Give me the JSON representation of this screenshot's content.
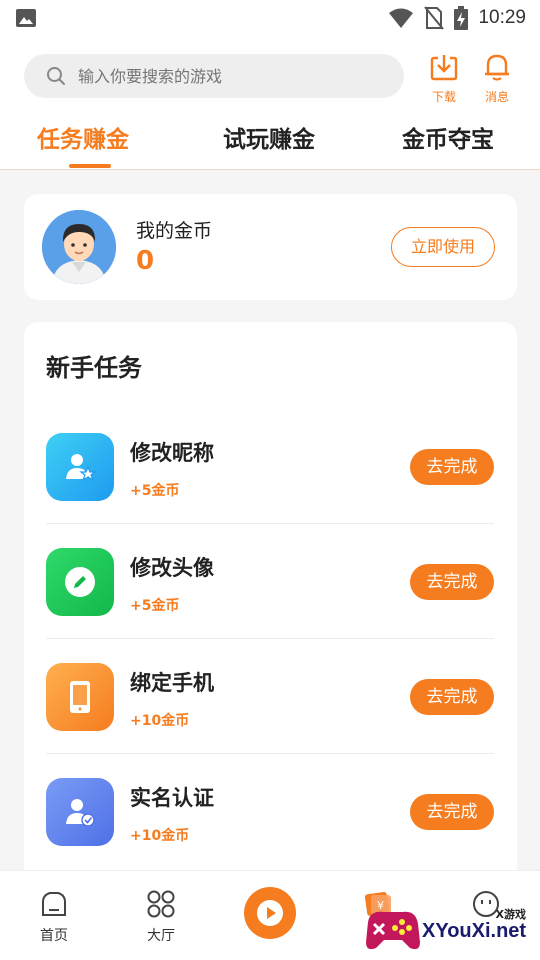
{
  "status_bar": {
    "time": "10:29"
  },
  "search": {
    "placeholder": "输入你要搜索的游戏"
  },
  "top_actions": {
    "download_label": "下载",
    "message_label": "消息"
  },
  "tabs": [
    {
      "label": "任务赚金",
      "active": true
    },
    {
      "label": "试玩赚金",
      "active": false
    },
    {
      "label": "金币夺宝",
      "active": false
    }
  ],
  "coins": {
    "label": "我的金币",
    "value": "0",
    "use_button": "立即使用"
  },
  "tasks": {
    "title": "新手任务",
    "items": [
      {
        "name": "修改昵称",
        "reward": "+5金币",
        "button": "去完成",
        "icon": "user-star-icon"
      },
      {
        "name": "修改头像",
        "reward": "+5金币",
        "button": "去完成",
        "icon": "edit-pencil-icon"
      },
      {
        "name": "绑定手机",
        "reward": "+10金币",
        "button": "去完成",
        "icon": "phone-icon"
      },
      {
        "name": "实名认证",
        "reward": "+10金币",
        "button": "去完成",
        "icon": "verified-user-icon"
      }
    ]
  },
  "bottom_nav": [
    {
      "label": "首页",
      "icon": "home-icon"
    },
    {
      "label": "大厅",
      "icon": "grid-icon"
    },
    {
      "label": "",
      "icon": "play-icon"
    },
    {
      "label": "",
      "icon": "coupon-icon"
    },
    {
      "label": "",
      "icon": "smile-icon"
    }
  ],
  "watermark": {
    "small": "X游戏",
    "big": "XYouXi.net"
  },
  "colors": {
    "accent": "#f57c1f",
    "background": "#f5f5f5"
  }
}
